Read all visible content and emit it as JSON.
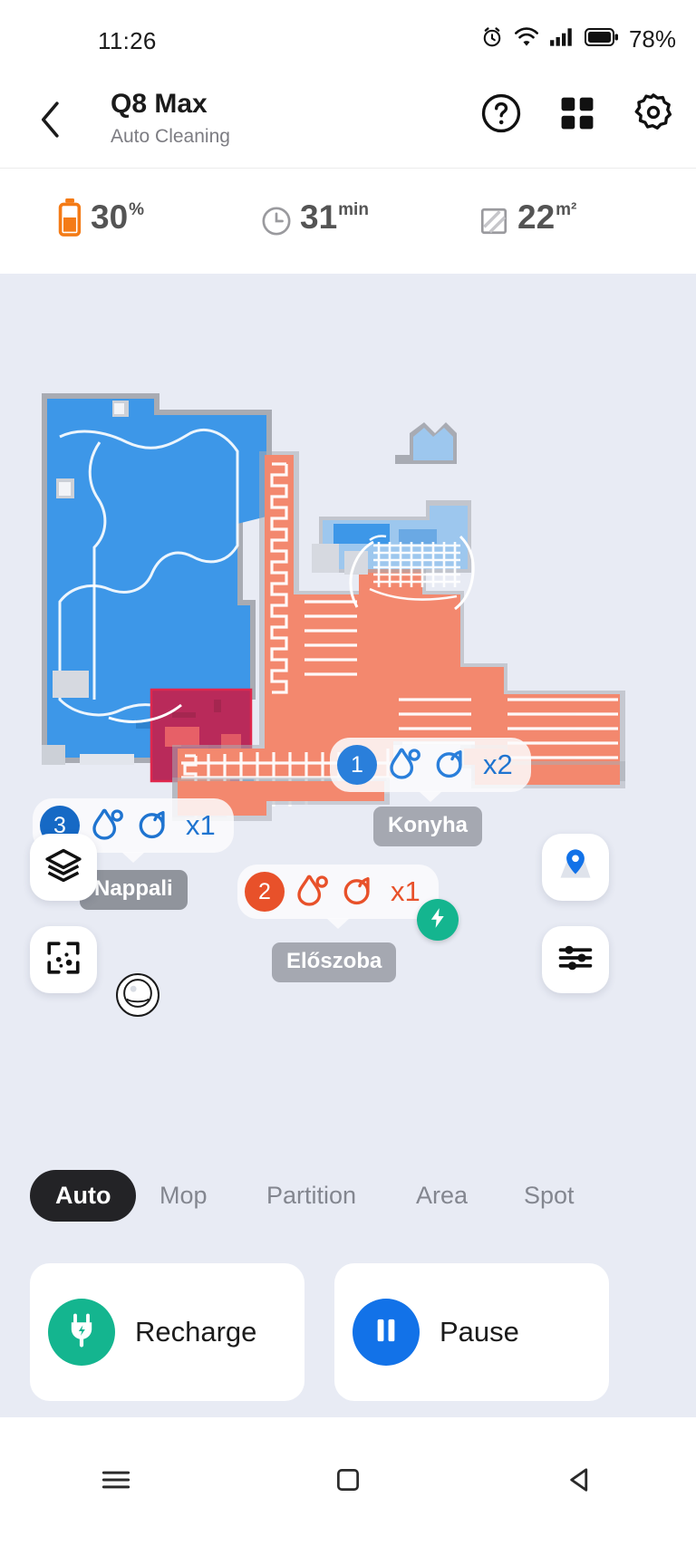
{
  "statusbar": {
    "time": "11:26",
    "battery_percent": "78%",
    "icons": [
      "alarm-icon",
      "wifi-icon",
      "signal-icon",
      "battery-icon"
    ]
  },
  "appbar": {
    "back_icon": "chevron-left-icon",
    "title": "Q8 Max",
    "subtitle": "Auto Cleaning",
    "actions": [
      {
        "name": "help-icon",
        "label": "Help"
      },
      {
        "name": "grid-icon",
        "label": "Rooms"
      },
      {
        "name": "gear-icon",
        "label": "Settings"
      }
    ]
  },
  "stats": [
    {
      "icon": "battery-icon",
      "value": "30",
      "unit": "%",
      "color": "#f47b16"
    },
    {
      "icon": "clock-icon",
      "value": "31",
      "unit": "min",
      "color": "#9a9a9e"
    },
    {
      "icon": "area-icon",
      "value": "22",
      "unit": "m²",
      "color": "#9a9a9e"
    }
  ],
  "map": {
    "room_labels": [
      {
        "name": "Nappali"
      },
      {
        "name": "Konyha"
      },
      {
        "name": "Előszoba"
      }
    ],
    "bubbles": [
      {
        "order": "1",
        "water_icon": "water-drop-icon",
        "repeat_icon": "repeat-icon",
        "multiplier": "x2",
        "color": "#2a7fdb"
      },
      {
        "order": "2",
        "water_icon": "water-drop-icon",
        "repeat_icon": "repeat-icon",
        "multiplier": "x1",
        "color": "#e8512a"
      },
      {
        "order": "3",
        "water_icon": "water-drop-icon",
        "repeat_icon": "repeat-icon",
        "multiplier": "x1",
        "color": "#1669c5"
      }
    ],
    "dock_icon": "charging-dock-icon",
    "robot_icon": "robot-vacuum-icon",
    "colors": {
      "background": "#e8ebf4",
      "cleaned_blue": "#3d97e8",
      "cleaned_orange": "#f3886e",
      "no_go_zone": "#b92a5a",
      "wall": "#a8abb3"
    },
    "controls": [
      {
        "name": "map-layers-button",
        "icon": "layers-icon"
      },
      {
        "name": "dirt-detection-button",
        "icon": "dirt-zone-icon"
      },
      {
        "name": "map-pin-button",
        "icon": "map-pin-icon"
      },
      {
        "name": "map-settings-button",
        "icon": "sliders-icon"
      }
    ]
  },
  "tabs": [
    {
      "label": "Auto",
      "active": true
    },
    {
      "label": "Mop",
      "active": false
    },
    {
      "label": "Partition",
      "active": false
    },
    {
      "label": "Area",
      "active": false
    },
    {
      "label": "Spot",
      "active": false
    }
  ],
  "actions": [
    {
      "label": "Recharge",
      "icon": "plug-icon",
      "color": "#14b58f"
    },
    {
      "label": "Pause",
      "icon": "pause-icon",
      "color": "#1272e8"
    }
  ],
  "navbar": [
    {
      "name": "menu-icon"
    },
    {
      "name": "home-icon"
    },
    {
      "name": "back-icon"
    }
  ]
}
